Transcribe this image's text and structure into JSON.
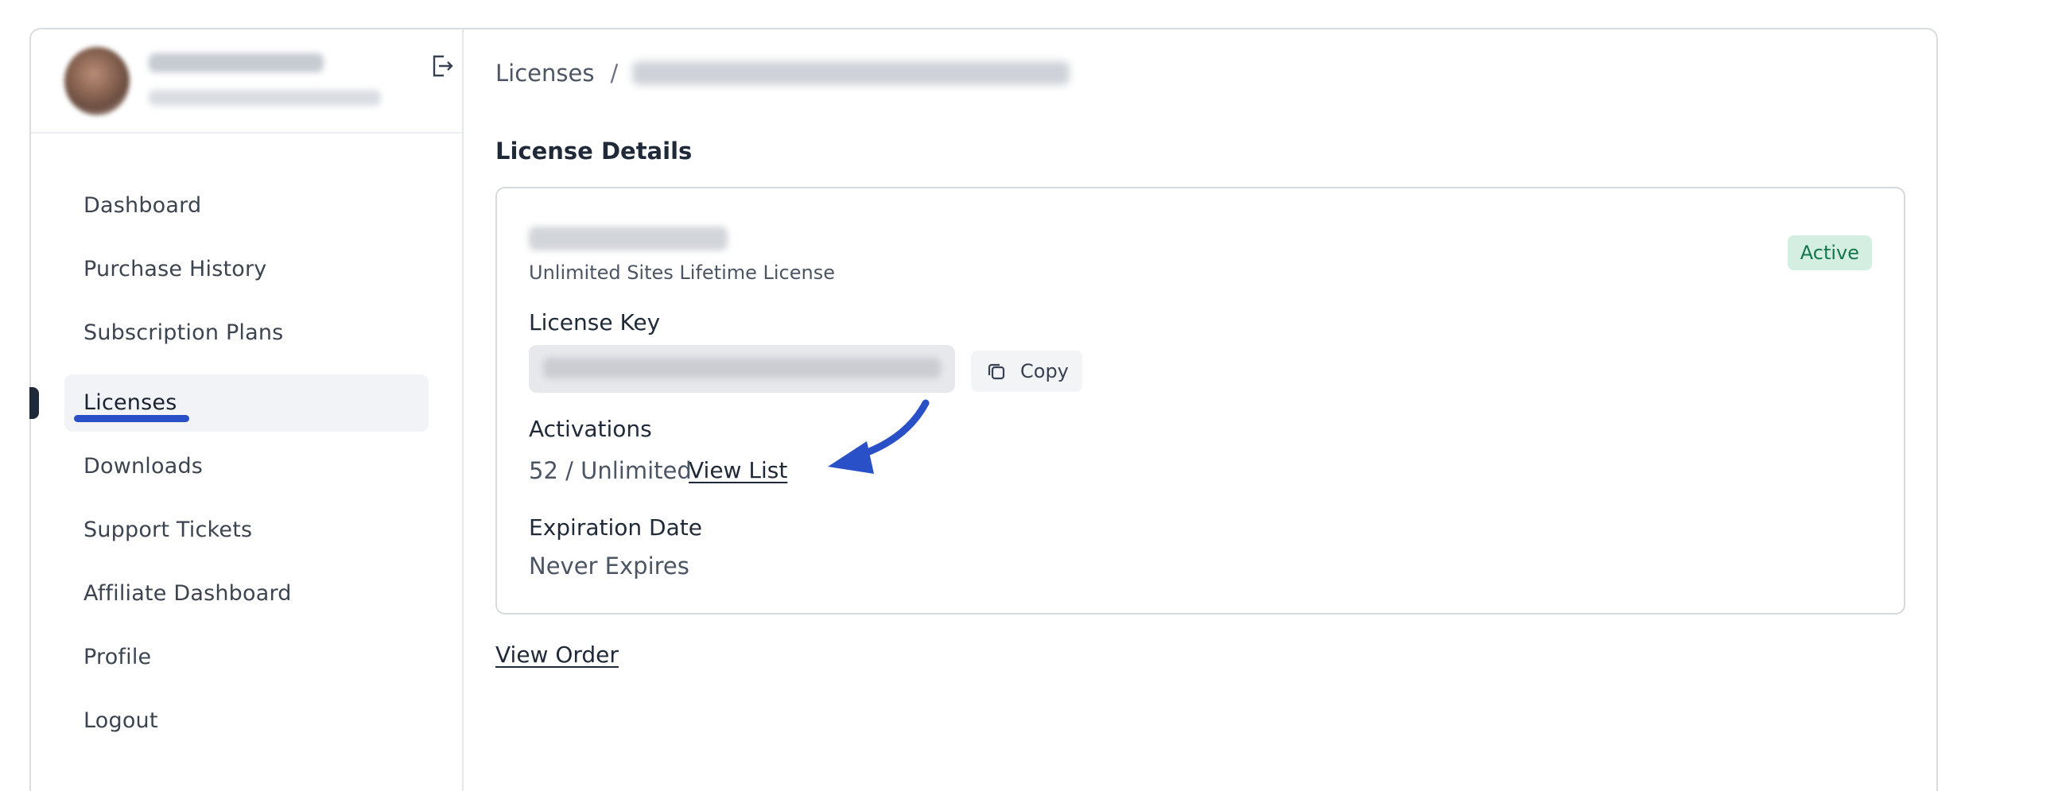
{
  "sidebar": {
    "items": [
      {
        "label": "Dashboard"
      },
      {
        "label": "Purchase History"
      },
      {
        "label": "Subscription Plans"
      },
      {
        "label": "Licenses",
        "active": true
      },
      {
        "label": "Downloads"
      },
      {
        "label": "Support Tickets"
      },
      {
        "label": "Affiliate Dashboard"
      },
      {
        "label": "Profile"
      },
      {
        "label": "Logout"
      }
    ]
  },
  "breadcrumb": {
    "root": "Licenses",
    "separator": "/"
  },
  "main": {
    "section_title": "License Details",
    "license": {
      "type": "Unlimited Sites Lifetime License",
      "status": "Active",
      "key_label": "License Key",
      "copy_label": "Copy",
      "activations_label": "Activations",
      "activations_value": "52 / Unlimited",
      "view_list_label": "View List",
      "expiration_label": "Expiration Date",
      "expiration_value": "Never Expires"
    },
    "view_order_label": "View Order"
  },
  "colors": {
    "accent_annotation": "#2a50c8",
    "status_active_bg": "#d5eee2",
    "status_active_text": "#14764b",
    "active_marker": "#1e2a3b"
  },
  "icons": {
    "logout": "exit-icon",
    "copy": "copy-icon"
  }
}
